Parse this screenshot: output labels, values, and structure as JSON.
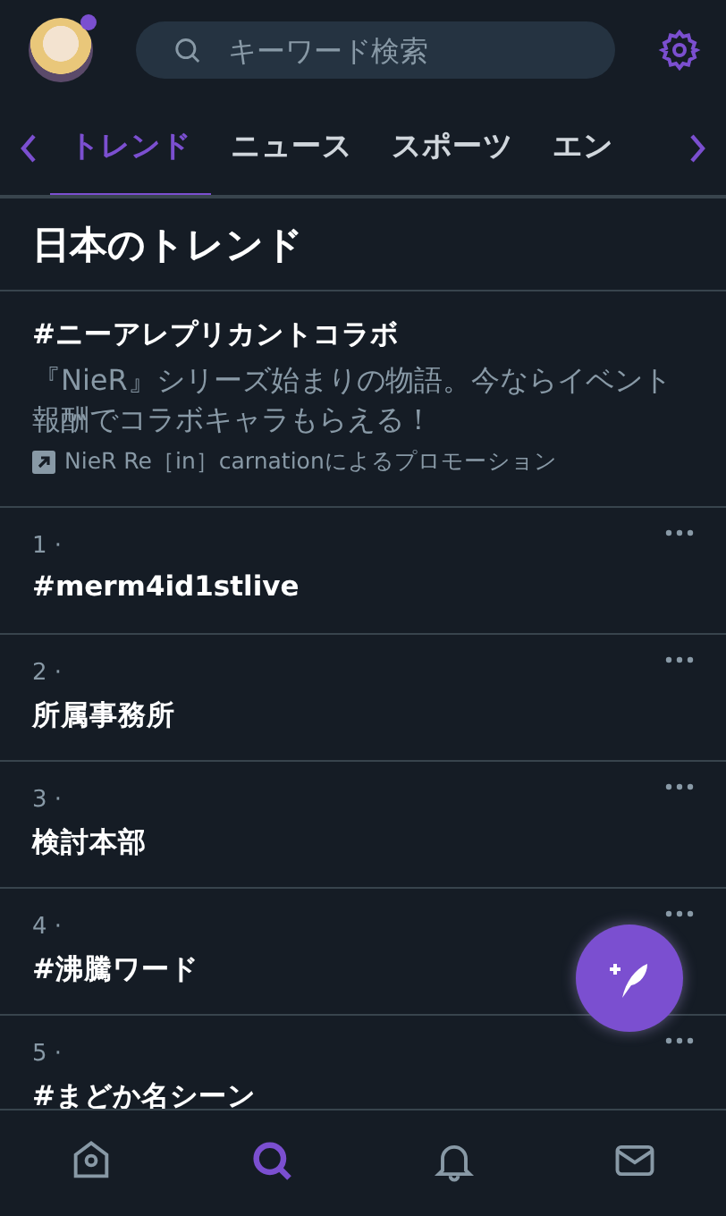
{
  "header": {
    "search": {
      "placeholder": "キーワード検索"
    },
    "avatar_dot": true
  },
  "tabs": [
    {
      "label": "トレンド",
      "selected": true
    },
    {
      "label": "ニュース",
      "selected": false
    },
    {
      "label": "スポーツ",
      "selected": false
    },
    {
      "label": "エン",
      "selected": false
    }
  ],
  "section_title": "日本のトレンド",
  "promo": {
    "title": "#ニーアレプリカントコラボ",
    "description": "『NieR』シリーズ始まりの物語。今ならイベント報酬でコラボキャラもらえる！",
    "sponsor": "NieR Re［in］carnationによるプロモーション"
  },
  "trends": [
    {
      "rank": "1 ·",
      "title": "#merm4id1stlive"
    },
    {
      "rank": "2 ·",
      "title": "所属事務所"
    },
    {
      "rank": "3 ·",
      "title": "検討本部"
    },
    {
      "rank": "4 ·",
      "title": "#沸騰ワード"
    },
    {
      "rank": "5 ·",
      "title": "#まどか名シーン"
    }
  ],
  "bottom_nav": [
    {
      "kind": "home",
      "selected": false
    },
    {
      "kind": "search",
      "selected": true
    },
    {
      "kind": "bell",
      "selected": false
    },
    {
      "kind": "mail",
      "selected": false
    }
  ]
}
